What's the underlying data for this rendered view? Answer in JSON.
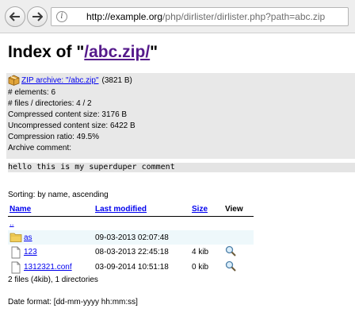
{
  "browser": {
    "url_host": "http://example.org",
    "url_path": "/php/dirlister/dirlister.php?path=abc.zip"
  },
  "page": {
    "title_prefix": "Index of \"",
    "title_link": "/abc.zip/",
    "title_suffix": "\""
  },
  "archive": {
    "link_label": "ZIP archive: \"/abc.zip\"",
    "size_label": "(3821 B)",
    "info_lines": [
      "# elements: 6",
      "# files / directories: 4 / 2",
      "Compressed content size: 3176 B",
      "Uncompressed content size: 6422 B",
      "Compression ratio: 49.5%",
      "Archive comment:"
    ],
    "comment": "hello this is my superduper comment"
  },
  "listing": {
    "sorting": "Sorting: by name, ascending",
    "headers": {
      "name": "Name",
      "modified": "Last modified",
      "size": "Size",
      "view": "View"
    },
    "parent_link": "..",
    "rows": [
      {
        "name": "as",
        "modified": "09-03-2013 02:07:48",
        "size": "",
        "type": "directory"
      },
      {
        "name": "123",
        "modified": "08-03-2013 22:45:18",
        "size": "4 kib",
        "type": "file"
      },
      {
        "name": "1312321.conf",
        "modified": "03-09-2014 10:51:18",
        "size": "0 kib",
        "type": "file"
      }
    ],
    "summary": "2 files (4kib), 1 directories",
    "date_format": "Date format: [dd-mm-yyyy hh:mm:ss]"
  },
  "colors": {
    "link": "#0000ee",
    "visited_link": "#551a8b",
    "archive_background": "#e8e8e8",
    "directory_row_background": "#eef8fb"
  },
  "icons": {
    "back": "arrow-left-icon",
    "forward": "arrow-right-icon",
    "site_info": "info-icon",
    "archive": "package-icon",
    "folder": "folder-icon",
    "file": "document-icon",
    "view": "magnifier-icon"
  }
}
